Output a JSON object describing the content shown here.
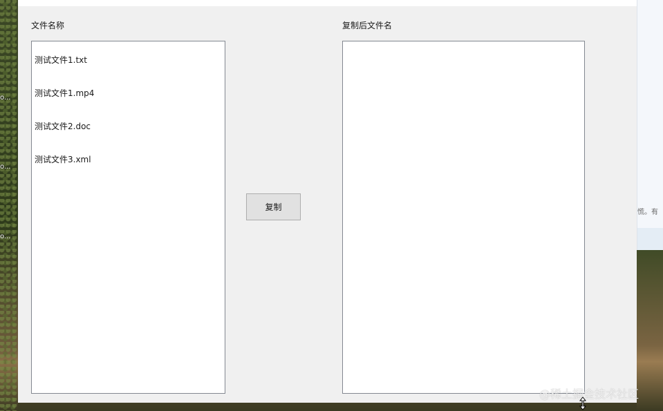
{
  "app": {
    "source_label": "文件名称",
    "target_label": "复制后文件名",
    "copy_button": "复制",
    "source_files": [
      "测试文件1.txt",
      "测试文件1.mp4",
      "测试文件2.doc",
      "测试文件3.xml"
    ],
    "target_files": []
  },
  "desktop": {
    "labels": [
      "o...",
      "o...",
      "o..."
    ],
    "right_text": "慌。有",
    "watermark": "@稀土掘金技术社区"
  }
}
